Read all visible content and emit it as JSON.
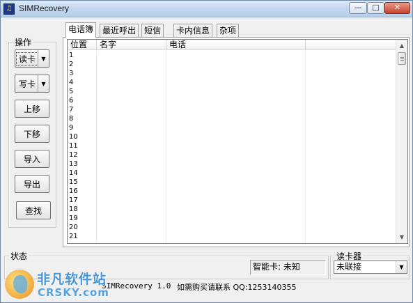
{
  "window": {
    "title": "SIMRecovery",
    "controls": {
      "minimize": "—",
      "maximize": "□",
      "close": "✕"
    }
  },
  "operations": {
    "group_label": "操作",
    "read_card": "读卡",
    "write_card": "写卡",
    "move_up": "上移",
    "move_down": "下移",
    "import": "导入",
    "export": "导出",
    "find": "查找"
  },
  "tabs": [
    {
      "label": "电话簿",
      "active": true
    },
    {
      "label": "最近呼出",
      "active": false
    },
    {
      "label": "短信",
      "active": false
    },
    {
      "label": "卡内信息",
      "active": false
    },
    {
      "label": "杂项",
      "active": false
    }
  ],
  "phonebook": {
    "columns": [
      "位置",
      "名字",
      "电话",
      ""
    ],
    "rows": [
      [
        "1",
        "",
        ""
      ],
      [
        "2",
        "",
        ""
      ],
      [
        "3",
        "",
        ""
      ],
      [
        "4",
        "",
        ""
      ],
      [
        "5",
        "",
        ""
      ],
      [
        "6",
        "",
        ""
      ],
      [
        "7",
        "",
        ""
      ],
      [
        "8",
        "",
        ""
      ],
      [
        "9",
        "",
        ""
      ],
      [
        "10",
        "",
        ""
      ],
      [
        "11",
        "",
        ""
      ],
      [
        "12",
        "",
        ""
      ],
      [
        "13",
        "",
        ""
      ],
      [
        "14",
        "",
        ""
      ],
      [
        "15",
        "",
        ""
      ],
      [
        "16",
        "",
        ""
      ],
      [
        "17",
        "",
        ""
      ],
      [
        "18",
        "",
        ""
      ],
      [
        "19",
        "",
        ""
      ],
      [
        "20",
        "",
        ""
      ],
      [
        "21",
        "",
        ""
      ]
    ]
  },
  "status": {
    "group_label": "状态",
    "smart_card_label": "智能卡: 未知"
  },
  "reader": {
    "group_label": "读卡器",
    "selected": "未联接"
  },
  "footer": {
    "version": "SIMRecovery 1.0",
    "purchase": "如需购买请联系 QQ:1253140355"
  },
  "watermark": {
    "cn": "非凡软件站",
    "en": "CRSKY.com"
  },
  "icons": {
    "app": "sim-card-icon",
    "dropdown": "chevron-down-icon",
    "scroll_up": "scroll-up-arrow-icon",
    "scroll_down": "scroll-down-arrow-icon"
  }
}
